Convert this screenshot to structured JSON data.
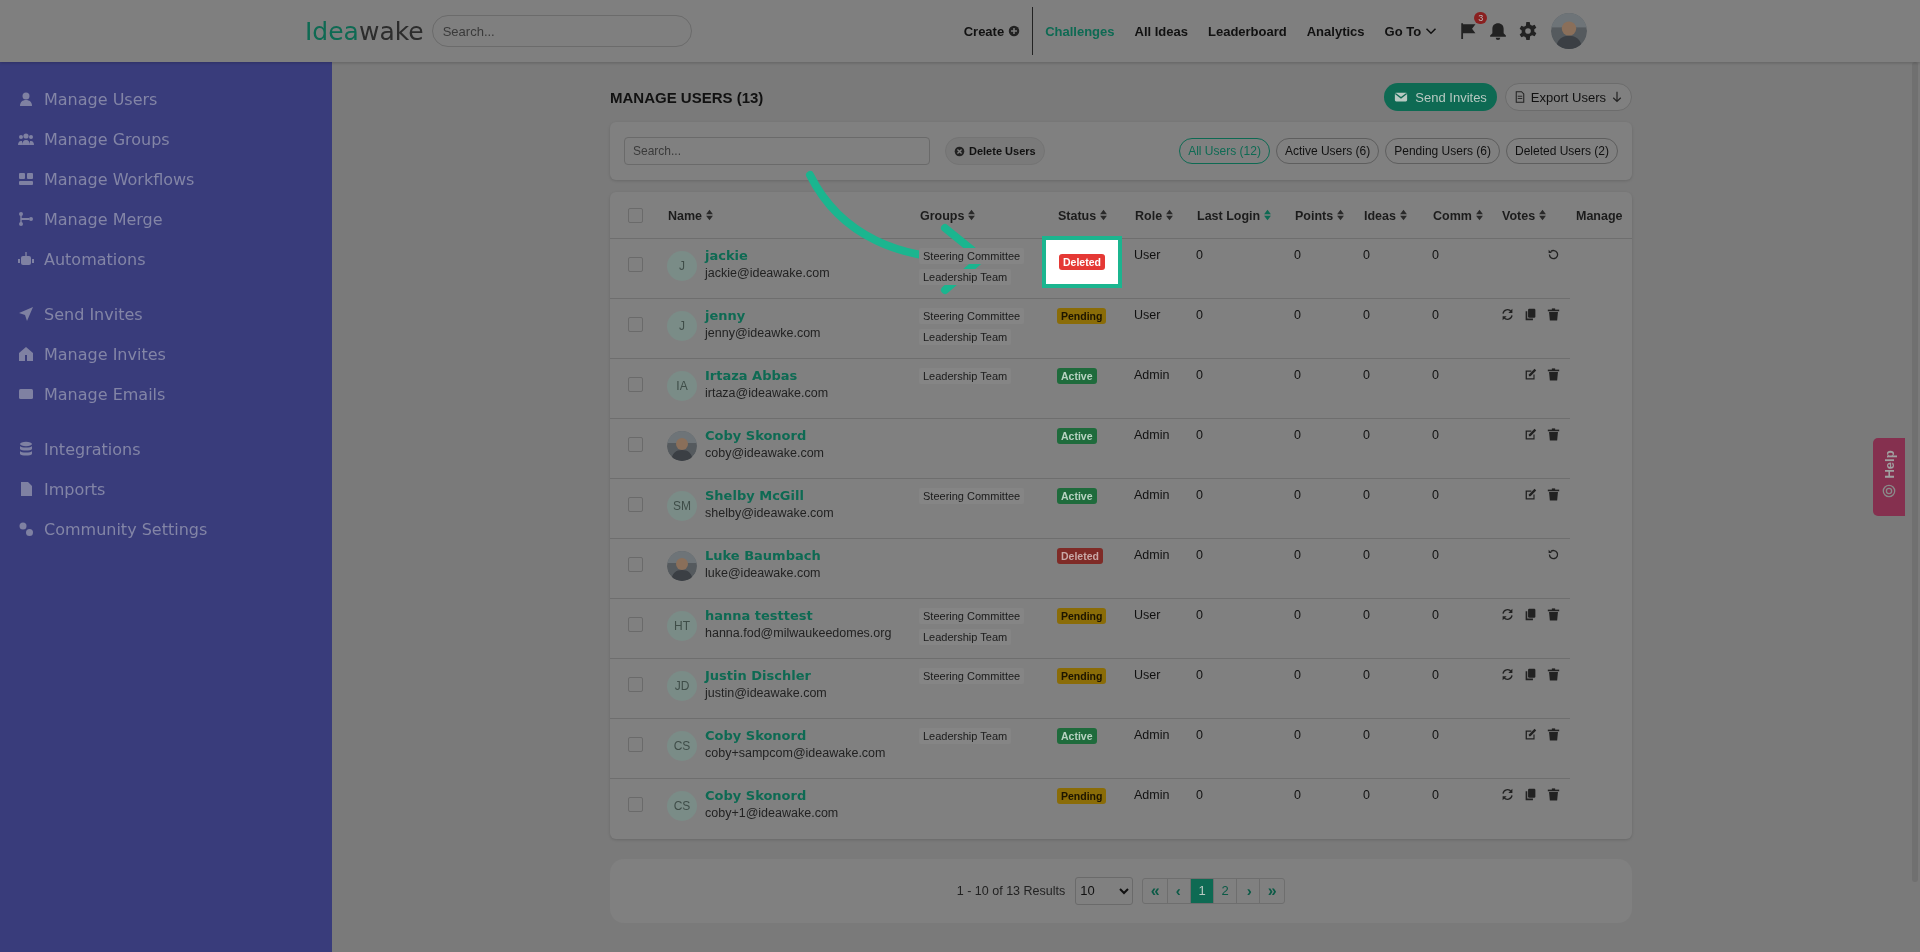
{
  "header": {
    "logo": {
      "prefix": "Idea",
      "suffix": "wake"
    },
    "search": {
      "placeholder": "Search..."
    },
    "nav": [
      {
        "label": "Create",
        "kind": "create",
        "selected": false
      },
      {
        "label": "Challenges",
        "kind": "link",
        "selected": true
      },
      {
        "label": "All Ideas",
        "kind": "link",
        "selected": false
      },
      {
        "label": "Leaderboard",
        "kind": "link",
        "selected": false
      },
      {
        "label": "Analytics",
        "kind": "link",
        "selected": false
      },
      {
        "label": "Go To",
        "kind": "menu",
        "selected": false
      }
    ],
    "notification_count": "3"
  },
  "sidebar": {
    "sections": [
      {
        "items": [
          {
            "label": "Manage Users"
          },
          {
            "label": "Manage Groups"
          },
          {
            "label": "Manage Workflows"
          },
          {
            "label": "Manage Merge"
          },
          {
            "label": "Automations"
          }
        ]
      },
      {
        "items": [
          {
            "label": "Send Invites"
          },
          {
            "label": "Manage Invites"
          },
          {
            "label": "Manage Emails"
          }
        ]
      },
      {
        "items": [
          {
            "label": "Integrations"
          },
          {
            "label": "Imports"
          },
          {
            "label": "Community Settings"
          }
        ]
      }
    ]
  },
  "page": {
    "title": "MANAGE USERS (13)",
    "send_invites": "Send Invites",
    "export_users": "Export Users",
    "search": {
      "placeholder": "Search..."
    },
    "delete_users": "Delete Users",
    "filters": [
      {
        "label": "All Users (12)",
        "selected": true
      },
      {
        "label": "Active Users (6)",
        "selected": false
      },
      {
        "label": "Pending Users (6)",
        "selected": false
      },
      {
        "label": "Deleted Users (2)",
        "selected": false
      }
    ]
  },
  "table": {
    "all_checked": false,
    "columns": [
      {
        "label": "Name",
        "sorted": false
      },
      {
        "label": "Groups",
        "sorted": false
      },
      {
        "label": "Status",
        "sorted": false
      },
      {
        "label": "Role",
        "sorted": false
      },
      {
        "label": "Last Login",
        "sorted": true
      },
      {
        "label": "Points",
        "sorted": false
      },
      {
        "label": "Ideas",
        "sorted": false
      },
      {
        "label": "Comm",
        "sorted": false
      },
      {
        "label": "Votes",
        "sorted": false
      },
      {
        "label": "Manage"
      }
    ],
    "rows": [
      {
        "checked": false,
        "name": "jackie",
        "email": "jackie@ideawake.com",
        "initials": "J",
        "groups": [
          "Steering Committee",
          "Leadership Team"
        ],
        "status": {
          "label": "Deleted",
          "kind": "deleted"
        },
        "highlighted": true,
        "role": "User",
        "points": "0",
        "ideas": "0",
        "comm": "0",
        "votes": "0"
      },
      {
        "checked": false,
        "name": "jenny",
        "email": "jenny@ideawke.com",
        "initials": "J",
        "groups": [
          "Steering Committee",
          "Leadership Team"
        ],
        "status": {
          "label": "Pending",
          "kind": "pending"
        },
        "highlighted": false,
        "role": "User",
        "points": "0",
        "ideas": "0",
        "comm": "0",
        "votes": "0"
      },
      {
        "checked": false,
        "name": "Irtaza Abbas",
        "email": "irtaza@ideawake.com",
        "initials": "IA",
        "groups": [
          "Leadership Team"
        ],
        "status": {
          "label": "Active",
          "kind": "active"
        },
        "highlighted": false,
        "role": "Admin",
        "points": "0",
        "ideas": "0",
        "comm": "0",
        "votes": "0"
      },
      {
        "checked": false,
        "name": "Coby Skonord",
        "email": "coby@ideawake.com",
        "groups": [],
        "status": {
          "label": "Active",
          "kind": "active"
        },
        "highlighted": false,
        "role": "Admin",
        "points": "0",
        "ideas": "0",
        "comm": "0",
        "votes": "0"
      },
      {
        "checked": false,
        "name": "Shelby McGill",
        "email": "shelby@ideawake.com",
        "initials": "SM",
        "groups": [
          "Steering Committee"
        ],
        "status": {
          "label": "Active",
          "kind": "active"
        },
        "highlighted": false,
        "role": "Admin",
        "points": "0",
        "ideas": "0",
        "comm": "0",
        "votes": "0"
      },
      {
        "checked": false,
        "name": "Luke Baumbach",
        "email": "luke@ideawake.com",
        "groups": [],
        "status": {
          "label": "Deleted",
          "kind": "deleted"
        },
        "highlighted": false,
        "role": "Admin",
        "points": "0",
        "ideas": "0",
        "comm": "0",
        "votes": "0"
      },
      {
        "checked": false,
        "name": "hanna testtest",
        "email": "hanna.fod@milwaukeedomes.org",
        "initials": "HT",
        "groups": [
          "Steering Committee",
          "Leadership Team"
        ],
        "status": {
          "label": "Pending",
          "kind": "pending"
        },
        "highlighted": false,
        "role": "User",
        "points": "0",
        "ideas": "0",
        "comm": "0",
        "votes": "0"
      },
      {
        "checked": false,
        "name": "Justin Dischler",
        "email": "justin@ideawake.com",
        "initials": "JD",
        "groups": [
          "Steering Committee"
        ],
        "status": {
          "label": "Pending",
          "kind": "pending"
        },
        "highlighted": false,
        "role": "User",
        "points": "0",
        "ideas": "0",
        "comm": "0",
        "votes": "0"
      },
      {
        "checked": false,
        "name": "Coby Skonord",
        "email": "coby+sampcom@ideawake.com",
        "initials": "CS",
        "groups": [
          "Leadership Team"
        ],
        "status": {
          "label": "Active",
          "kind": "active"
        },
        "highlighted": false,
        "role": "Admin",
        "points": "0",
        "ideas": "0",
        "comm": "0",
        "votes": "0"
      },
      {
        "checked": false,
        "name": "Coby Skonord",
        "email": "coby+1@ideawake.com",
        "initials": "CS",
        "groups": [],
        "status": {
          "label": "Pending",
          "kind": "pending"
        },
        "highlighted": false,
        "role": "Admin",
        "points": "0",
        "ideas": "0",
        "comm": "0",
        "votes": "0"
      }
    ]
  },
  "pagination": {
    "summary": "1 - 10 of 13 Results",
    "page_size": "10",
    "buttons": [
      {
        "label": "«",
        "kind": "first",
        "selected": false
      },
      {
        "label": "‹",
        "kind": "prev",
        "selected": false
      },
      {
        "label": "1",
        "kind": "page",
        "selected": true
      },
      {
        "label": "2",
        "kind": "page",
        "selected": false
      },
      {
        "label": "›",
        "kind": "next",
        "selected": false
      },
      {
        "label": "»",
        "kind": "last",
        "selected": false
      }
    ]
  },
  "help": {
    "label": "Help"
  }
}
